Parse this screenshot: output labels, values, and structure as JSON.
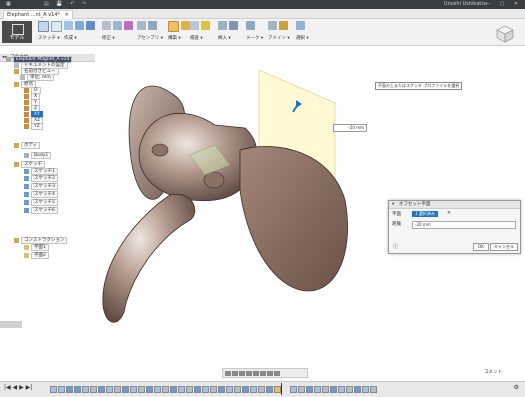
{
  "title_bar": {
    "quick_access": "▤ 💾 ↶ ↷",
    "user": "Unoshi Ushikatsu",
    "window_controls": "— ▢ ✕"
  },
  "tab": {
    "label": "Elephant ...nt_A v14*",
    "close": "✕"
  },
  "ribbon": {
    "workspace": "モデル",
    "groups": [
      {
        "label": "スケッチ ▾"
      },
      {
        "label": "作成 ▾"
      },
      {
        "label": "修正 ▾"
      },
      {
        "label": "アセンブリ ▾"
      },
      {
        "label": "構築 ▾"
      },
      {
        "label": "検査 ▾"
      },
      {
        "label": "挿入 ▾"
      },
      {
        "label": "メーク ▾"
      },
      {
        "label": "アドイン ▾"
      },
      {
        "label": "選択 ▾"
      }
    ]
  },
  "browser": {
    "header": "ブラウザ",
    "root": "Elephant Magnet_A v14",
    "items": [
      {
        "label": "ドキュメントの設定"
      },
      {
        "label": "名前付きビュー"
      },
      {
        "label": "単位: mm"
      },
      {
        "label": "原点"
      },
      {
        "label": "O"
      },
      {
        "label": "X"
      },
      {
        "label": "Y"
      },
      {
        "label": "Z"
      },
      {
        "label": "XY"
      },
      {
        "label": "XZ"
      },
      {
        "label": "YZ"
      },
      {
        "label": "ボディ"
      },
      {
        "label": "Body1"
      },
      {
        "label": "スケッチ"
      },
      {
        "label": "スケッチ1"
      },
      {
        "label": "スケッチ2"
      },
      {
        "label": "スケッチ3"
      },
      {
        "label": "スケッチ4"
      },
      {
        "label": "スケッチ5"
      },
      {
        "label": "スケッチ6"
      },
      {
        "label": "コンストラクション"
      },
      {
        "label": "平面1"
      },
      {
        "label": "平面2"
      }
    ]
  },
  "viewport": {
    "tooltip": "平面の上またはスケッチ プロファイルを選択",
    "offset_value": "-20 mm",
    "accent_color": "#1f74c8"
  },
  "dialog": {
    "title": "オフセット平面",
    "plane_label": "平面",
    "plane_value": "1 選択済み",
    "distance_label": "距離",
    "distance_value": "-20 mm",
    "ok": "OK",
    "cancel": "キャンセル"
  },
  "status": {
    "comments": "コメント"
  },
  "timeline": {
    "playback": "|◀ ◀ ▶ ▶|"
  }
}
